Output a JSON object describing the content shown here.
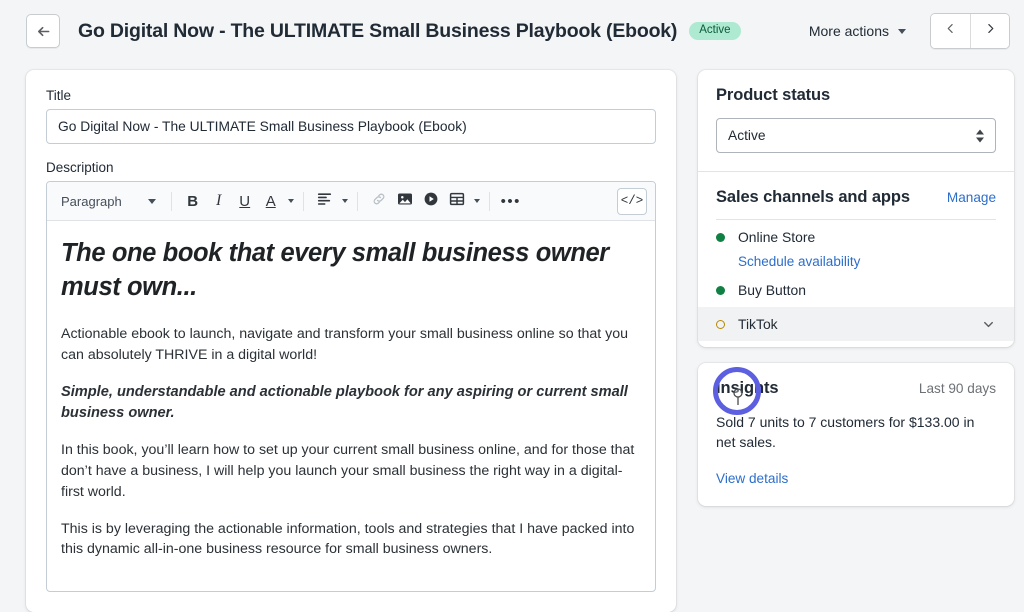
{
  "header": {
    "back_icon": "arrow-left-icon",
    "title": "Go Digital Now - The ULTIMATE Small Business Playbook (Ebook)",
    "status_badge": "Active",
    "more_actions_label": "More actions",
    "prev_icon": "chevron-left-icon",
    "next_icon": "chevron-right-icon"
  },
  "main": {
    "title_label": "Title",
    "title_value": "Go Digital Now - The ULTIMATE Small Business Playbook (Ebook)",
    "description_label": "Description",
    "toolbar": {
      "block_format": "Paragraph",
      "bold": "B",
      "italic": "I",
      "underline": "U",
      "text_color": "A",
      "align_icon": "align-left-icon",
      "link_icon": "link-icon",
      "image_icon": "image-icon",
      "video_icon": "video-icon",
      "table_icon": "table-icon",
      "more_icon": "ellipsis-icon",
      "more_label": "•••",
      "code_icon": "code-icon",
      "code_label": "</>"
    },
    "body": {
      "heading": "The one book that every small business owner must own...",
      "paragraph_1": "Actionable ebook to launch, navigate and transform your small business online so that you can absolutely THRIVE in a digital world!",
      "paragraph_2": "Simple, understandable and actionable playbook for any aspiring or current small business owner.",
      "paragraph_3": "In this book, you’ll learn how to set up your current small business online, and for those that don’t have a business, I will help you launch your small business the right way in a digital-first world.",
      "paragraph_4": "This is by leveraging the actionable information, tools and strategies that I have packed into this dynamic all-in-one business resource for small business owners."
    }
  },
  "sidebar": {
    "product_status": {
      "title": "Product status",
      "selected": "Active"
    },
    "sales_channels": {
      "title": "Sales channels and apps",
      "manage_label": "Manage",
      "items": [
        {
          "name": "Online Store",
          "status": "active",
          "sublink": "Schedule availability"
        },
        {
          "name": "Buy Button",
          "status": "active"
        },
        {
          "name": "TikTok",
          "status": "pending",
          "chevron_icon": "chevron-down-icon"
        }
      ]
    },
    "insights": {
      "title": "Insights",
      "range": "Last 90 days",
      "summary": "Sold 7 units to 7 customers for $133.00 in net sales.",
      "link": "View details"
    }
  },
  "overlay": {
    "click_ring_color": "#5b5fe0",
    "cursor_icon": "pointer-cursor"
  },
  "colors": {
    "page_bg": "#f4f5f6",
    "card_bg": "#ffffff",
    "text": "#212b36",
    "link": "#2c6ecb",
    "badge_bg": "#aee9d1",
    "badge_text": "#0b5c3a",
    "status_active": "#108043",
    "status_pending": "#b98900"
  }
}
